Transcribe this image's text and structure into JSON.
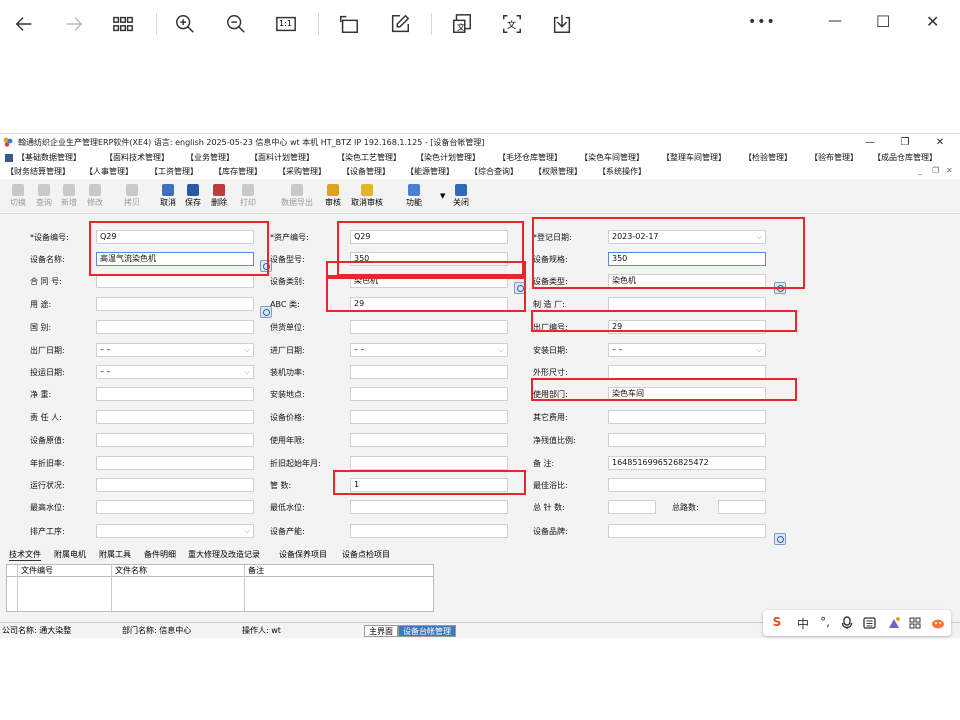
{
  "viewer": {
    "icons": [
      "back-arrow-icon",
      "forward-arrow-icon",
      "grid-view-icon",
      "zoom-in-icon",
      "zoom-out-icon",
      "actual-size-icon",
      "rotate-icon",
      "edit-icon",
      "translate-page-icon",
      "translate-text-icon",
      "save-icon",
      "more-icon",
      "minimize-icon",
      "maximize-icon",
      "close-icon"
    ],
    "actual_size_label": "1:1",
    "translate_glyph": "文",
    "more_label": "•••",
    "window_controls": {
      "minimize": "—",
      "maximize": "☐",
      "close": "✕"
    }
  },
  "app": {
    "title": "翰通纺织企业生产管理ERP软件(XE4)  语言: english  2025-05-23  信息中心 wt 本机 HT_BTZ IP 192.168.1.125 - [设备台帐管理]",
    "window_controls": {
      "minimize": "—",
      "restore": "❐",
      "close": "✕"
    },
    "mdi_controls": {
      "minimize": "_",
      "restore": "❐",
      "close": "✕"
    },
    "menu_row1": [
      "【基础数据管理】",
      "【面料技术管理】",
      "【业务管理】",
      "【面料计划管理】",
      "【染色工艺管理】",
      "【染色计划管理】",
      "【毛坯仓库管理】",
      "【染色车间管理】",
      "【整理车间管理】",
      "【检验管理】",
      "【验布管理】",
      "【成品仓库管理】"
    ],
    "menu_row2": [
      "【财务结算管理】",
      "【人事管理】",
      "【工资管理】",
      "【库存管理】",
      "【采购管理】",
      "【设备管理】",
      "【能源管理】",
      "【综合查询】",
      "【权限管理】",
      "【系统操作】"
    ],
    "toolbar": [
      {
        "label": "切换",
        "enabled": false
      },
      {
        "label": "查询",
        "enabled": false
      },
      {
        "label": "新增",
        "enabled": false
      },
      {
        "label": "修改",
        "enabled": false
      },
      {
        "label": "拷贝",
        "enabled": false
      },
      {
        "label": "取消",
        "enabled": true
      },
      {
        "label": "保存",
        "enabled": true
      },
      {
        "label": "删除",
        "enabled": true
      },
      {
        "label": "打印",
        "enabled": false
      },
      {
        "label": "数据导出",
        "enabled": false
      },
      {
        "label": "审核",
        "enabled": true
      },
      {
        "label": "取消审核",
        "enabled": true
      },
      {
        "label": "功能",
        "enabled": true
      },
      {
        "label": "关闭",
        "enabled": true
      }
    ]
  },
  "form": {
    "col1": [
      {
        "label": "*设备编号:",
        "value": "Q29"
      },
      {
        "label": "设备名称:",
        "value": "高温气流染色机"
      },
      {
        "label": "合 同 号:",
        "value": ""
      },
      {
        "label": "用     途:",
        "value": ""
      },
      {
        "label": "国     别:",
        "value": ""
      },
      {
        "label": "出厂日期:",
        "value": "–  –"
      },
      {
        "label": "投运日期:",
        "value": "–  –"
      },
      {
        "label": "净     重:",
        "value": ""
      },
      {
        "label": "责 任 人:",
        "value": ""
      },
      {
        "label": "设备原值:",
        "value": ""
      },
      {
        "label": "年折旧率:",
        "value": ""
      },
      {
        "label": "运行状况:",
        "value": ""
      },
      {
        "label": "最高水位:",
        "value": ""
      },
      {
        "label": "排产工序:",
        "value": ""
      }
    ],
    "col2": [
      {
        "label": "*资产编号:",
        "value": "Q29"
      },
      {
        "label": "设备型号:",
        "value": "350"
      },
      {
        "label": "设备类别:",
        "value": "染色机"
      },
      {
        "label": "ABC 类:",
        "value": "29"
      },
      {
        "label": "供货单位:",
        "value": ""
      },
      {
        "label": "进厂日期:",
        "value": "–  –"
      },
      {
        "label": "装机功率:",
        "value": ""
      },
      {
        "label": "安装地点:",
        "value": ""
      },
      {
        "label": "设备价格:",
        "value": ""
      },
      {
        "label": "使用年限:",
        "value": ""
      },
      {
        "label": "折旧起始年月:",
        "value": ""
      },
      {
        "label": "管     数:",
        "value": "1"
      },
      {
        "label": "最低水位:",
        "value": ""
      },
      {
        "label": "设备产能:",
        "value": ""
      }
    ],
    "col3": [
      {
        "label": "*登记日期:",
        "value": "2023-02-17"
      },
      {
        "label": "设备规格:",
        "value": "350"
      },
      {
        "label": "设备类型:",
        "value": "染色机"
      },
      {
        "label": "制 造 厂:",
        "value": ""
      },
      {
        "label": "出厂编号:",
        "value": "29"
      },
      {
        "label": "安装日期:",
        "value": "–  –"
      },
      {
        "label": "外形尺寸:",
        "value": ""
      },
      {
        "label": "使用部门:",
        "value": "染色车间"
      },
      {
        "label": "其它费用:",
        "value": ""
      },
      {
        "label": "净残值比例:",
        "value": ""
      },
      {
        "label": "备     注:",
        "value": "1648516996526825472"
      },
      {
        "label": "最佳浴比:",
        "value": ""
      },
      {
        "label": "总 针 数:",
        "value": ""
      },
      {
        "label": "设备品牌:",
        "value": ""
      }
    ],
    "total_ways_label": "总路数:",
    "total_ways_value": ""
  },
  "detail_tabs": [
    "技术文件",
    "附属电机",
    "附属工具",
    "备件明细",
    "重大修理及改造记录",
    "设备保养项目",
    "设备点检项目"
  ],
  "grid": {
    "columns": [
      "文件编号",
      "文件名称",
      "备注"
    ]
  },
  "status": {
    "company": "公司名称: 通大染整",
    "dept": "部门名称: 信息中心",
    "operator": "操作人: wt",
    "windows": [
      "主界面",
      "设备台帐管理"
    ]
  },
  "ime": {
    "items": [
      "S",
      "中",
      "°,",
      "mic-icon",
      "keyboard-icon",
      "skin-icon",
      "apps-icon",
      "mascot-icon"
    ],
    "mode_label": "中",
    "punct_label": "°,"
  }
}
